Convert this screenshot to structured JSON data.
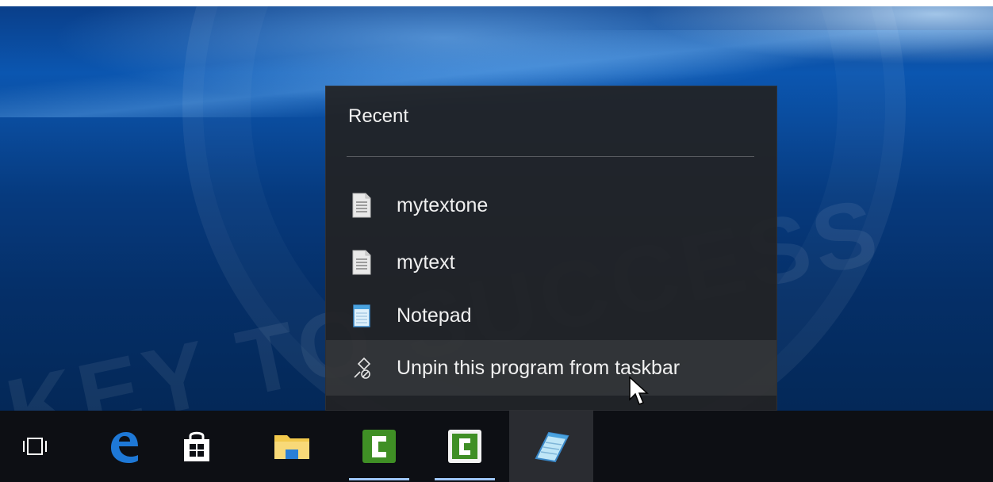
{
  "jumplist": {
    "title": "Recent",
    "items": [
      {
        "label": "mytextone",
        "icon": "text-file-icon"
      },
      {
        "label": "mytext",
        "icon": "text-file-icon"
      },
      {
        "label": "Notepad",
        "icon": "notepad-icon"
      },
      {
        "label": "Unpin this program from taskbar",
        "icon": "unpin-icon"
      }
    ]
  },
  "taskbar": {
    "buttons": [
      {
        "name": "task-view-icon"
      },
      {
        "name": "edge-icon"
      },
      {
        "name": "store-icon"
      },
      {
        "name": "file-explorer-icon"
      },
      {
        "name": "camtasia-icon",
        "running": true
      },
      {
        "name": "camtasia-recorder-icon",
        "running": true
      },
      {
        "name": "notepad-icon",
        "active": true
      }
    ]
  },
  "watermark": {
    "text": "KEY TO SUCCESS"
  },
  "colors": {
    "accent": "#9ec6ff",
    "menu_bg": "#222224",
    "taskbar_bg": "#0d0f14",
    "edge_blue": "#1e78d6",
    "camtasia_green": "#3f8f25"
  }
}
